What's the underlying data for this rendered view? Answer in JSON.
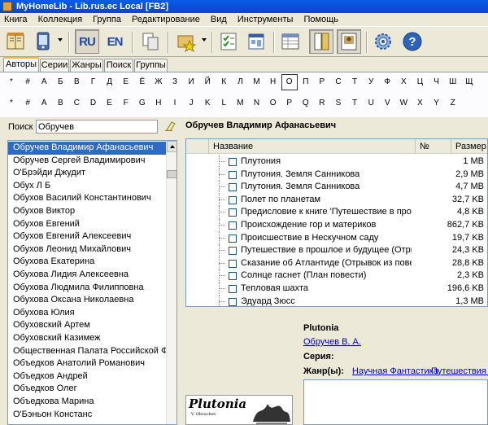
{
  "window": {
    "title": "MyHomeLib - Lib.rus.ec Local [FB2]"
  },
  "menu": [
    "Книга",
    "Коллекция",
    "Группа",
    "Редактирование",
    "Вид",
    "Инструменты",
    "Помощь"
  ],
  "toolbar": {
    "ru_label": "RU",
    "en_label": "EN"
  },
  "tabs": [
    "Авторы",
    "Серии",
    "Жанры",
    "Поиск",
    "Группы"
  ],
  "alphabet": {
    "cyrillic": [
      "*",
      "#",
      "А",
      "Б",
      "В",
      "Г",
      "Д",
      "Е",
      "Ё",
      "Ж",
      "З",
      "И",
      "Й",
      "К",
      "Л",
      "М",
      "Н",
      "О",
      "П",
      "Р",
      "С",
      "Т",
      "У",
      "Ф",
      "Х",
      "Ц",
      "Ч",
      "Ш",
      "Щ"
    ],
    "latin": [
      "*",
      "#",
      "A",
      "B",
      "C",
      "D",
      "E",
      "F",
      "G",
      "H",
      "I",
      "J",
      "K",
      "L",
      "M",
      "N",
      "O",
      "P",
      "Q",
      "R",
      "S",
      "T",
      "U",
      "V",
      "W",
      "X",
      "Y",
      "Z"
    ],
    "selected": "О"
  },
  "search": {
    "label": "Поиск",
    "value": "Обручев"
  },
  "author_heading": "Обручев Владимир Афанасьевич",
  "authors": [
    "Обручев Владимир Афанасьевич",
    "Обручев Сергей Владимирович",
    "О'Брэйди Джудит",
    "Обух Л Б",
    "Обухов Василий Константинович",
    "Обухов Виктор",
    "Обухов Евгений",
    "Обухов Евгений Алексеевич",
    "Обухов Леонид Михайлович",
    "Обухова Екатерина",
    "Обухова Лидия Алексеевна",
    "Обухова Людмила Филипповна",
    "Обухова Оксана Николаевна",
    "Обухова Юлия",
    "Обуховский Артем",
    "Обуховский Казимеж",
    "Общественная Палата Российской Федерации",
    "Объедков Анатолий Романович",
    "Объедков Андрей",
    "Объедков Олег",
    "Объедкова Марина",
    "О'Бэньон Констанс"
  ],
  "book_columns": {
    "name": "Название",
    "num": "№",
    "size": "Размер"
  },
  "books": [
    {
      "title": "Плутония",
      "size": "1 MB"
    },
    {
      "title": "Плутония. Земля Санникова",
      "size": "2,9 MB"
    },
    {
      "title": "Плутония. Земля Санникова",
      "size": "4,7 MB"
    },
    {
      "title": "Полет по планетам",
      "size": "32,7 KB"
    },
    {
      "title": "Предисловие к книге 'Путешествие в прошл...",
      "size": "4,8 KB"
    },
    {
      "title": "Происхождение гор и материков",
      "size": "862,7 KB"
    },
    {
      "title": "Происшествие в Нескучном саду",
      "size": "19,7 KB"
    },
    {
      "title": "Путешествие в прошлое и будущее (Отрыво...",
      "size": "24,3 KB"
    },
    {
      "title": "Сказание об Атлантиде (Отрывок из повести)",
      "size": "28,8 KB"
    },
    {
      "title": "Солнце гаснет (План повести)",
      "size": "2,3 KB"
    },
    {
      "title": "Тепловая шахта",
      "size": "196,6 KB"
    },
    {
      "title": "Эдуард Зюсс",
      "size": "1,3 MB"
    }
  ],
  "details": {
    "title": "Plutonia",
    "author": "Обручев В. А.",
    "series_label": "Серия:",
    "genre_label": "Жанр(ы):",
    "genres": [
      "Научная Фантастика",
      "Путешествия и"
    ]
  },
  "cover": {
    "title": "Plutonia",
    "subtitle": "V. Obruchev"
  },
  "colors": {
    "selection": "#316ac5",
    "titlebar": "#0a5ce8",
    "link": "#0000cc"
  }
}
